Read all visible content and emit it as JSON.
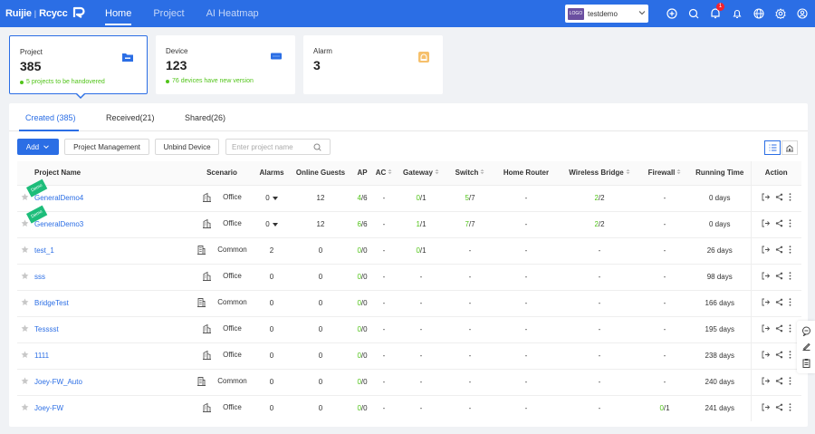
{
  "header": {
    "brand": "Ruijie",
    "brand_sub": "Rcycc",
    "nav": [
      "Home",
      "Project",
      "AI Heatmap"
    ],
    "org": {
      "logo": "LOGO",
      "name": "testdemo"
    },
    "icons": [
      "add-circle-icon",
      "search-icon",
      "message-icon",
      "bell-icon",
      "globe-icon",
      "gear-icon",
      "user-icon"
    ],
    "message_badge": "1"
  },
  "cards": [
    {
      "label": "Project",
      "value": "385",
      "note": "5 projects to be handovered",
      "icon": "folder-icon",
      "accent": "#2b6ee5"
    },
    {
      "label": "Device",
      "value": "123",
      "note": "76 devices have new version",
      "icon": "device-icon",
      "accent": "#2b6ee5"
    },
    {
      "label": "Alarm",
      "value": "3",
      "note": "",
      "icon": "alarm-icon",
      "accent": "#f0a93b"
    }
  ],
  "tabs": [
    "Created (385)",
    "Received(21)",
    "Shared(26)"
  ],
  "toolbar": {
    "add": "Add",
    "project_management": "Project Management",
    "unbind_device": "Unbind Device",
    "search_placeholder": "Enter project name"
  },
  "table": {
    "columns": [
      "Project Name",
      "Scenario",
      "Alarms",
      "Online Guests",
      "AP",
      "AC",
      "Gateway",
      "Switch",
      "Home Router",
      "Wireless Bridge",
      "Firewall",
      "Running Time",
      "Action"
    ],
    "rows": [
      {
        "name": "GeneralDemo4",
        "ribbon": "Demo",
        "scenario": "Office",
        "alarms": "0",
        "alarm_caret": true,
        "guests": "12",
        "ap": [
          "4",
          "/6"
        ],
        "ac": "-",
        "gateway": [
          "0",
          "/1"
        ],
        "switch": [
          "5",
          "/7"
        ],
        "router": "-",
        "bridge": [
          "2",
          "/2"
        ],
        "firewall": "-",
        "time": "0 days"
      },
      {
        "name": "GeneralDemo3",
        "ribbon": "Demo",
        "scenario": "Office",
        "alarms": "0",
        "alarm_caret": true,
        "guests": "12",
        "ap": [
          "6",
          "/6"
        ],
        "ac": "-",
        "gateway": [
          "1",
          "/1"
        ],
        "switch": [
          "7",
          "/7"
        ],
        "router": "-",
        "bridge": [
          "2",
          "/2"
        ],
        "firewall": "-",
        "time": "0 days"
      },
      {
        "name": "test_1",
        "ribbon": "",
        "scenario": "Common",
        "alarms": "2",
        "alarm_caret": false,
        "guests": "0",
        "ap": [
          "0",
          "/0"
        ],
        "ac": "-",
        "gateway": [
          "0",
          "/1"
        ],
        "switch": "-",
        "router": "-",
        "bridge": "-",
        "firewall": "-",
        "time": "26 days"
      },
      {
        "name": "sss",
        "ribbon": "",
        "scenario": "Office",
        "alarms": "0",
        "alarm_caret": false,
        "guests": "0",
        "ap": [
          "0",
          "/0"
        ],
        "ac": "-",
        "gateway": "-",
        "switch": "-",
        "router": "-",
        "bridge": "-",
        "firewall": "-",
        "time": "98 days"
      },
      {
        "name": "BridgeTest",
        "ribbon": "",
        "scenario": "Common",
        "alarms": "0",
        "alarm_caret": false,
        "guests": "0",
        "ap": [
          "0",
          "/0"
        ],
        "ac": "-",
        "gateway": "-",
        "switch": "-",
        "router": "-",
        "bridge": "-",
        "firewall": "-",
        "time": "166 days"
      },
      {
        "name": "Tesssst",
        "ribbon": "",
        "scenario": "Office",
        "alarms": "0",
        "alarm_caret": false,
        "guests": "0",
        "ap": [
          "0",
          "/0"
        ],
        "ac": "-",
        "gateway": "-",
        "switch": "-",
        "router": "-",
        "bridge": "-",
        "firewall": "-",
        "time": "195 days"
      },
      {
        "name": "1111",
        "ribbon": "",
        "scenario": "Office",
        "alarms": "0",
        "alarm_caret": false,
        "guests": "0",
        "ap": [
          "0",
          "/0"
        ],
        "ac": "-",
        "gateway": "-",
        "switch": "-",
        "router": "-",
        "bridge": "-",
        "firewall": "-",
        "time": "238 days"
      },
      {
        "name": "Joey-FW_Auto",
        "ribbon": "",
        "scenario": "Common",
        "alarms": "0",
        "alarm_caret": false,
        "guests": "0",
        "ap": [
          "0",
          "/0"
        ],
        "ac": "-",
        "gateway": "-",
        "switch": "-",
        "router": "-",
        "bridge": "-",
        "firewall": "-",
        "time": "240 days"
      },
      {
        "name": "Joey-FW",
        "ribbon": "",
        "scenario": "Office",
        "alarms": "0",
        "alarm_caret": false,
        "guests": "0",
        "ap": [
          "0",
          "/0"
        ],
        "ac": "-",
        "gateway": "-",
        "switch": "-",
        "router": "-",
        "bridge": "-",
        "firewall": [
          "0",
          "/1"
        ],
        "time": "241 days"
      }
    ]
  }
}
